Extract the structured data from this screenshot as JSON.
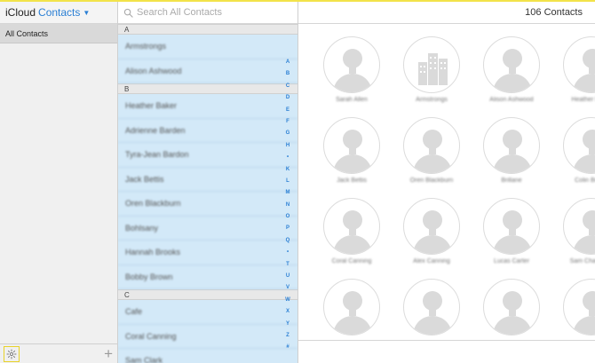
{
  "brand": {
    "icloud": "iCloud",
    "app": "Contacts"
  },
  "sidebar": {
    "groups": [
      {
        "label": "All Contacts"
      }
    ]
  },
  "search": {
    "placeholder": "Search All Contacts"
  },
  "main": {
    "count": "106 Contacts"
  },
  "index_letters": [
    "A",
    "B",
    "C",
    "D",
    "E",
    "F",
    "G",
    "H",
    "•",
    "K",
    "L",
    "M",
    "N",
    "O",
    "P",
    "Q",
    "•",
    "T",
    "U",
    "V",
    "W",
    "X",
    "Y",
    "Z",
    "#"
  ],
  "list": {
    "sections": [
      {
        "letter": "A",
        "contacts": [
          "Armstrongs",
          "Alison Ashwood"
        ]
      },
      {
        "letter": "B",
        "contacts": [
          "Heather Baker",
          "Adrienne Barden",
          "Tyra-Jean Bardon",
          "Jack Bettis",
          "Oren Blackburn",
          "Bohlsany",
          "Hannah Brooks",
          "Bobby Brown"
        ]
      },
      {
        "letter": "C",
        "contacts": [
          "Cafe",
          "Coral Canning",
          "Sam Clark"
        ]
      }
    ]
  },
  "grid": {
    "cards": [
      {
        "name": "Sarah Allen",
        "icon": "person-icon"
      },
      {
        "name": "Armstrongs",
        "icon": "building-icon"
      },
      {
        "name": "Alison Ashwood",
        "icon": "person-icon"
      },
      {
        "name": "Heather Baker",
        "icon": "person-icon"
      },
      {
        "name": "Jack Bettis",
        "icon": "person-icon"
      },
      {
        "name": "Oren Blackburn",
        "icon": "person-icon"
      },
      {
        "name": "Brillane",
        "icon": "person-icon"
      },
      {
        "name": "Colin Brown",
        "icon": "person-icon"
      },
      {
        "name": "Coral Canning",
        "icon": "person-icon"
      },
      {
        "name": "Alex Canning",
        "icon": "person-icon"
      },
      {
        "name": "Lucas Carter",
        "icon": "person-icon"
      },
      {
        "name": "Sam Chambers",
        "icon": "person-icon"
      },
      {
        "name": "",
        "icon": "person-icon"
      },
      {
        "name": "",
        "icon": "person-icon"
      },
      {
        "name": "",
        "icon": "person-icon"
      },
      {
        "name": "",
        "icon": "person-icon"
      }
    ]
  }
}
